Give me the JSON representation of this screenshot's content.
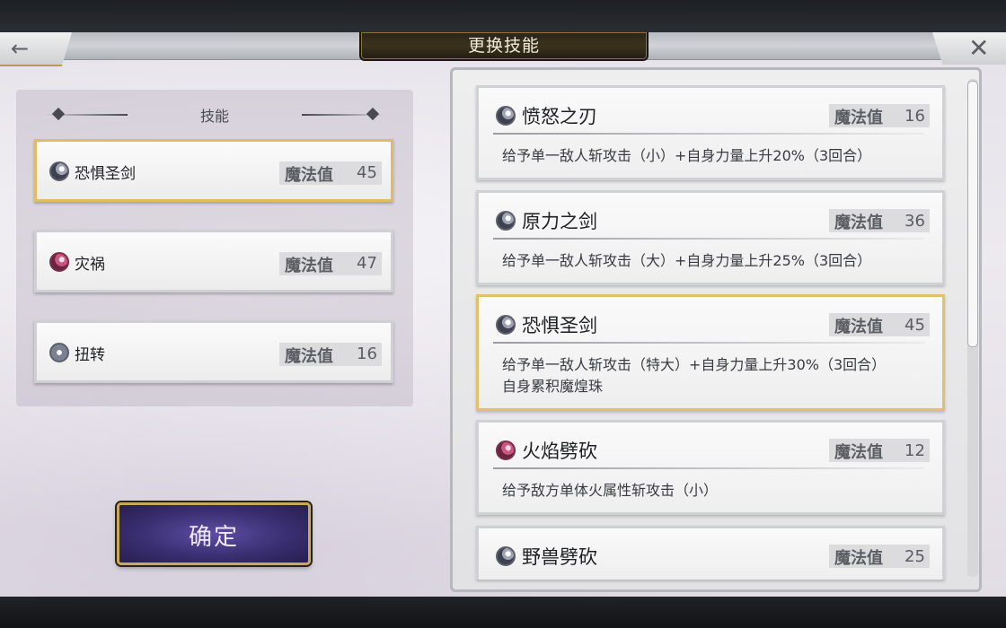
{
  "header": {
    "title": "更换技能",
    "back_icon": "←",
    "close_icon": "✕"
  },
  "current_skills": {
    "heading": "技能",
    "items": [
      {
        "name": "恐惧圣剑",
        "mp_label": "魔法值",
        "mp": "45",
        "icon": "slash-orb-icon",
        "selected": true
      },
      {
        "name": "灾祸",
        "mp_label": "魔法值",
        "mp": "47",
        "icon": "pink-orb-icon",
        "selected": false
      },
      {
        "name": "扭转",
        "mp_label": "魔法值",
        "mp": "16",
        "icon": "star-orb-icon",
        "selected": false
      }
    ]
  },
  "confirm_button": {
    "label": "确定"
  },
  "skill_list": [
    {
      "name": "愤怒之刃",
      "mp_label": "魔法值",
      "mp": "16",
      "desc": "给予单一敌人斩攻击（小）+自身力量上升20%（3回合）",
      "desc2": "",
      "icon": "slash-orb-icon",
      "selected": false
    },
    {
      "name": "原力之剑",
      "mp_label": "魔法值",
      "mp": "36",
      "desc": "给予单一敌人斩攻击（大）+自身力量上升25%（3回合）",
      "desc2": "",
      "icon": "slash-orb-icon",
      "selected": false
    },
    {
      "name": "恐惧圣剑",
      "mp_label": "魔法值",
      "mp": "45",
      "desc": "给予单一敌人斩攻击（特大）+自身力量上升30%（3回合）",
      "desc2": "自身累积魔煌珠",
      "icon": "slash-orb-icon",
      "selected": true
    },
    {
      "name": "火焰劈砍",
      "mp_label": "魔法值",
      "mp": "12",
      "desc": "给予敌方单体火属性斩攻击（小）",
      "desc2": "",
      "icon": "pink-orb-icon",
      "selected": false
    },
    {
      "name": "野兽劈砍",
      "mp_label": "魔法值",
      "mp": "25",
      "desc": "",
      "desc2": "",
      "icon": "slash-orb-icon",
      "selected": false
    }
  ],
  "colors": {
    "selected_border": "#e2bc63",
    "confirm_button": "#3a2f72",
    "title_plate": "#3b321d"
  }
}
